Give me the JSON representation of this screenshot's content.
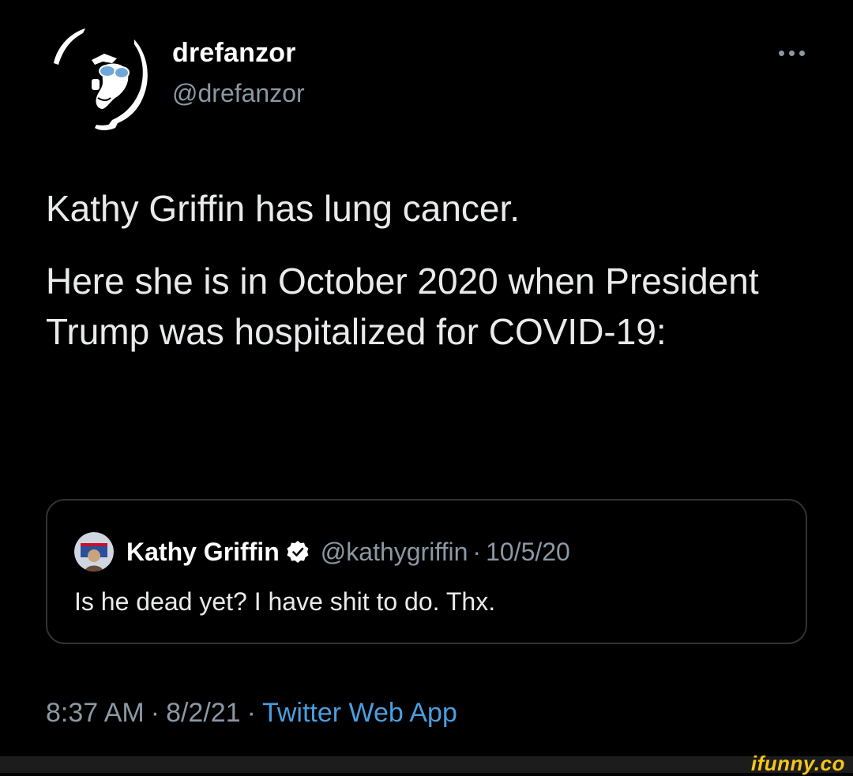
{
  "author": {
    "display_name": "drefanzor",
    "handle": "@drefanzor",
    "avatar_icon": "silhouette-face-with-sunglasses-avatar"
  },
  "more_icon": "more-dots-icon",
  "tweet": {
    "paragraphs": [
      "Kathy Griffin has lung cancer.",
      "Here she is in October 2020 when President Trump was hospitalized for COVID-19:"
    ]
  },
  "quoted_tweet": {
    "display_name": "Kathy Griffin",
    "verified_icon": "verified-badge-icon",
    "handle": "@kathygriffin",
    "separator": "·",
    "date": "10/5/20",
    "text": "Is he dead yet? I have shit to do. Thx."
  },
  "meta": {
    "time": "8:37 AM",
    "separator": "·",
    "date": "8/2/21",
    "source": "Twitter Web App"
  },
  "watermark": "ifunny.co",
  "colors": {
    "background": "#000000",
    "text": "#e8eaeb",
    "secondary": "#8b98a5",
    "link": "#4a9ee0",
    "border": "#2f3336",
    "watermark": "#f5c518"
  }
}
